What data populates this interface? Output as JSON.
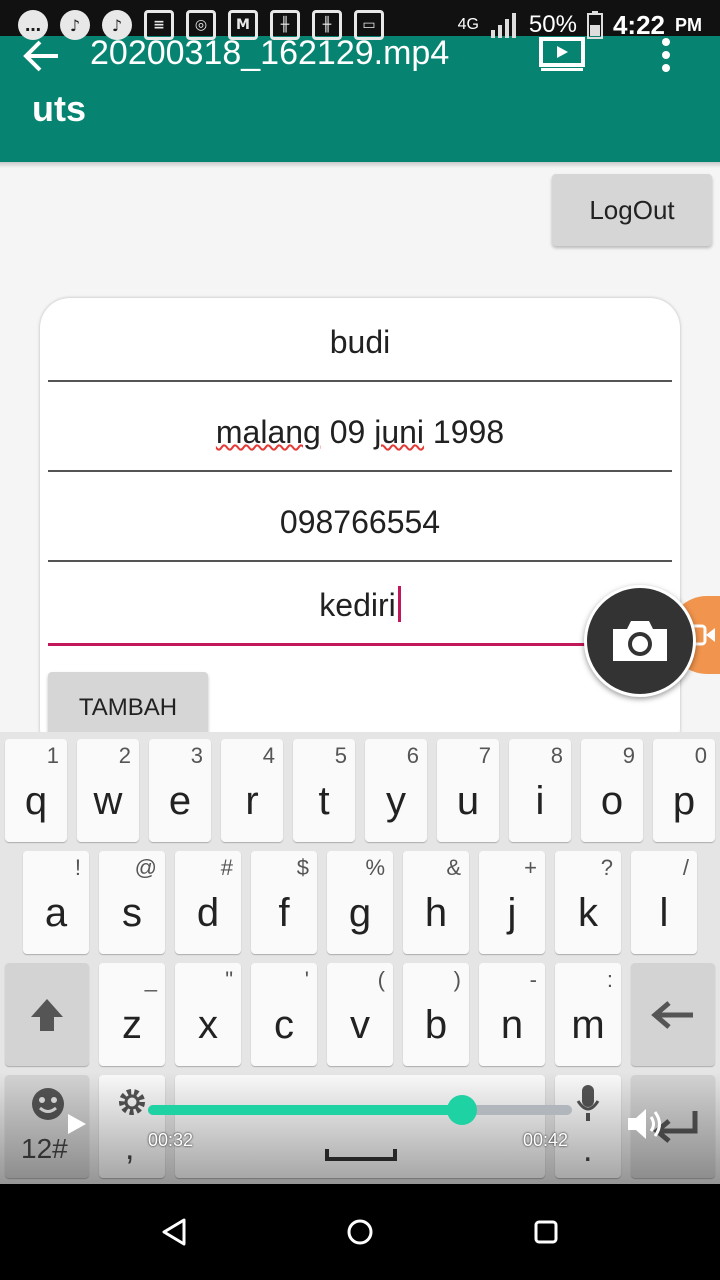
{
  "status_bar": {
    "battery": "50%",
    "time": "4:22",
    "ampm": "PM",
    "network": "4G"
  },
  "video_player": {
    "title": "20200318_162129.mp4",
    "current_time": "00:32",
    "total_time": "00:42",
    "progress": 0.74
  },
  "app": {
    "title": "uts",
    "logout_label": "LogOut",
    "fields": [
      "budi",
      "malang 09 juni 1998",
      "098766554",
      "kediri"
    ],
    "submit_label": "TAMBAH"
  },
  "keyboard": {
    "row1": [
      {
        "key": "q",
        "hint": "1"
      },
      {
        "key": "w",
        "hint": "2"
      },
      {
        "key": "e",
        "hint": "3"
      },
      {
        "key": "r",
        "hint": "4"
      },
      {
        "key": "t",
        "hint": "5"
      },
      {
        "key": "y",
        "hint": "6"
      },
      {
        "key": "u",
        "hint": "7"
      },
      {
        "key": "i",
        "hint": "8"
      },
      {
        "key": "o",
        "hint": "9"
      },
      {
        "key": "p",
        "hint": "0"
      }
    ],
    "row2": [
      {
        "key": "a",
        "hint": "!"
      },
      {
        "key": "s",
        "hint": "@"
      },
      {
        "key": "d",
        "hint": "#"
      },
      {
        "key": "f",
        "hint": "$"
      },
      {
        "key": "g",
        "hint": "%"
      },
      {
        "key": "h",
        "hint": "&"
      },
      {
        "key": "j",
        "hint": "+"
      },
      {
        "key": "k",
        "hint": "?"
      },
      {
        "key": "l",
        "hint": "/"
      }
    ],
    "row3": [
      {
        "key": "z",
        "hint": "_"
      },
      {
        "key": "x",
        "hint": "\""
      },
      {
        "key": "c",
        "hint": "'"
      },
      {
        "key": "v",
        "hint": "("
      },
      {
        "key": "b",
        "hint": ")"
      },
      {
        "key": "n",
        "hint": "-"
      },
      {
        "key": "m",
        "hint": ":"
      }
    ],
    "symbols_label": "12#",
    "comma": ",",
    "period": "."
  },
  "icons": {
    "back": "back-arrow-icon",
    "cast": "cast-icon",
    "more": "more-vertical-icon",
    "camera": "camera-icon",
    "video": "video-icon",
    "shift": "shift-icon",
    "backspace": "backspace-icon",
    "emoji": "emoji-icon",
    "settings": "gear-icon",
    "mic": "mic-icon",
    "enter": "enter-icon",
    "play": "play-icon",
    "volume": "volume-icon"
  },
  "colors": {
    "app_bar": "#078471",
    "accent": "#c2185b",
    "seek": "#1ed2a4",
    "camera_fab": "#333333",
    "video_fab": "#f08a3c"
  }
}
